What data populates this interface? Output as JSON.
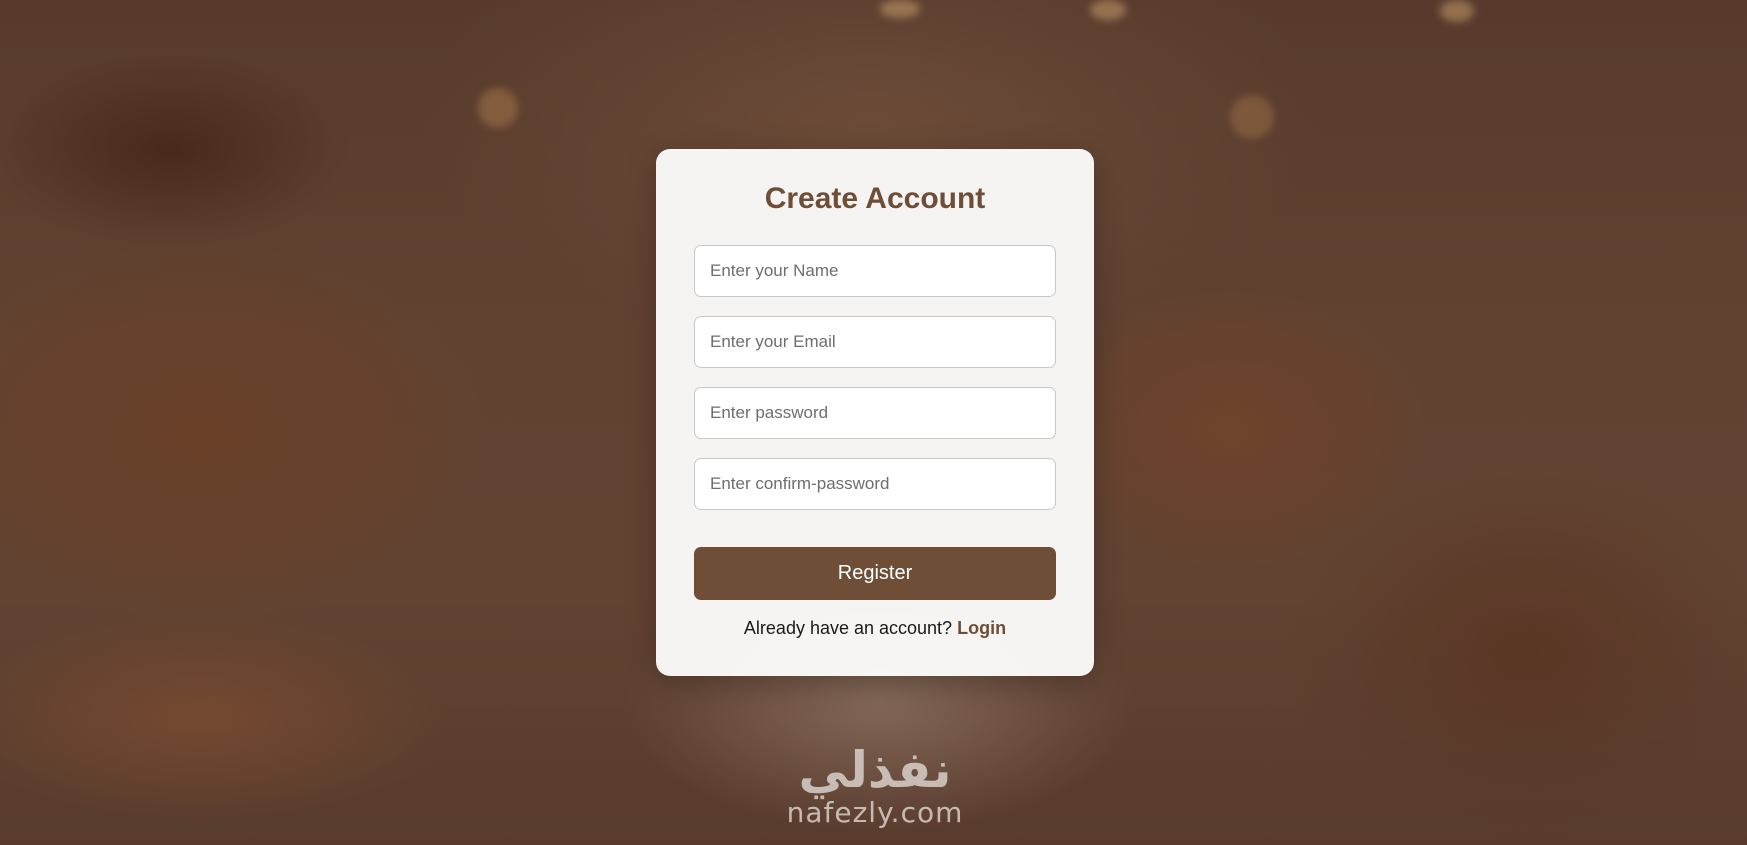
{
  "form": {
    "title": "Create Account",
    "fields": {
      "name": {
        "placeholder": "Enter your Name",
        "value": ""
      },
      "email": {
        "placeholder": "Enter your Email",
        "value": ""
      },
      "password": {
        "placeholder": "Enter password",
        "value": ""
      },
      "confirm_password": {
        "placeholder": "Enter confirm-password",
        "value": ""
      }
    },
    "register_label": "Register",
    "login_prompt": "Already have an account?",
    "login_link": "Login"
  },
  "watermark": {
    "arabic": "نفذلي",
    "latin": "nafezly.com"
  },
  "colors": {
    "accent": "#6f4e37",
    "card_background": "#ffffff",
    "button_text": "#ffffff"
  }
}
